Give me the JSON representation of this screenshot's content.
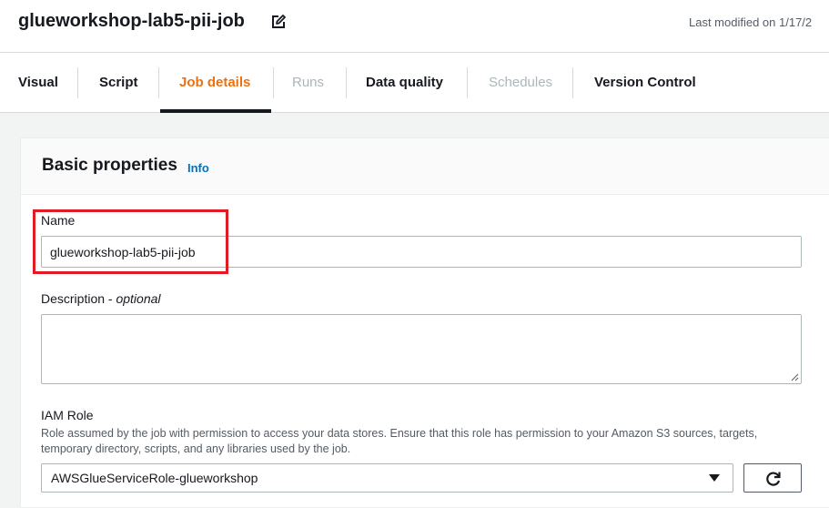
{
  "header": {
    "job_title": "glueworkshop-lab5-pii-job",
    "last_modified": "Last modified on 1/17/2"
  },
  "tabs": [
    {
      "label": "Visual",
      "state": "normal"
    },
    {
      "label": "Script",
      "state": "normal"
    },
    {
      "label": "Job details",
      "state": "active"
    },
    {
      "label": "Runs",
      "state": "disabled"
    },
    {
      "label": "Data quality",
      "state": "normal"
    },
    {
      "label": "Schedules",
      "state": "disabled"
    },
    {
      "label": "Version Control",
      "state": "normal"
    }
  ],
  "basic_properties": {
    "title": "Basic properties",
    "info_link": "Info",
    "name": {
      "label": "Name",
      "value": "glueworkshop-lab5-pii-job"
    },
    "description": {
      "label": "Description - ",
      "optional": "optional",
      "value": ""
    },
    "iam_role": {
      "label": "IAM Role",
      "hint": "Role assumed by the job with permission to access your data stores. Ensure that this role has permission to your Amazon S3 sources, targets, temporary directory, scripts, and any libraries used by the job.",
      "selected": "AWSGlueServiceRole-glueworkshop"
    }
  },
  "colors": {
    "accent": "#ec7211",
    "link": "#0073bb",
    "highlight": "#e01b24",
    "disabled_text": "#aab7b8"
  },
  "icons": {
    "edit": "edit-icon",
    "dropdown": "caret-down-icon",
    "refresh": "refresh-icon"
  }
}
